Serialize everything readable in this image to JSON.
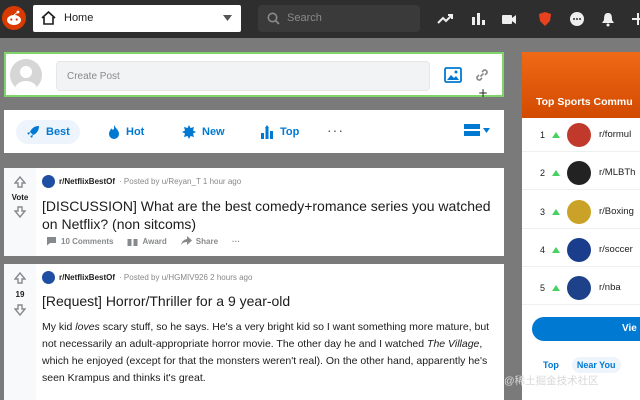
{
  "header": {
    "feed_selector": "Home",
    "search_placeholder": "Search",
    "icons": [
      "reddit-logo",
      "home-icon",
      "trending-icon",
      "stats-icon",
      "video-icon",
      "shield-icon",
      "chat-icon",
      "bell-icon",
      "plus-icon"
    ]
  },
  "create_post": {
    "placeholder": "Create Post"
  },
  "sort": {
    "items": [
      {
        "label": "Best",
        "icon": "rocket-icon",
        "active": true
      },
      {
        "label": "Hot",
        "icon": "flame-icon",
        "active": false
      },
      {
        "label": "New",
        "icon": "burst-icon",
        "active": false
      },
      {
        "label": "Top",
        "icon": "bar-chart-icon",
        "active": false
      }
    ],
    "more": "···"
  },
  "posts": [
    {
      "subreddit": "r/NetflixBestOf",
      "byline": "· Posted by u/Reyan_T 1 hour ago",
      "votes": "Vote",
      "title": "[DISCUSSION] What are the best comedy+romance series you watched on Netflix? (non sitcoms)",
      "actions": {
        "comments": "10 Comments",
        "award": "Award",
        "share": "Share",
        "more": "···"
      }
    },
    {
      "subreddit": "r/NetflixBestOf",
      "byline": "· Posted by u/HGMIV926 2 hours ago",
      "votes": "19",
      "title": "[Request] Horror/Thriller for a 9 year-old",
      "body_parts": {
        "p1": "My kid ",
        "p1_em": "loves",
        "p2": " scary stuff, so he says. He's a very bright kid so I want something more mature, but not necessarily an adult-appropriate horror movie. The other day he and I watched ",
        "p2_em": "The Village",
        "p3": ", which he enjoyed (except for that the monsters weren't real). On the other hand, apparently he's seen Krampus and thinks it's great."
      }
    }
  ],
  "sidebar": {
    "title": "Top Sports Commu",
    "communities": [
      {
        "rank": "1",
        "name": "r/formul",
        "color": "#c0392b"
      },
      {
        "rank": "2",
        "name": "r/MLBTh",
        "color": "#222222"
      },
      {
        "rank": "3",
        "name": "r/Boxing",
        "color": "#c9a227"
      },
      {
        "rank": "4",
        "name": "r/soccer",
        "color": "#1a3e8c"
      },
      {
        "rank": "5",
        "name": "r/nba",
        "color": "#1d428a"
      }
    ],
    "view_button": "Vie",
    "tabs": [
      "Top",
      "Near You"
    ]
  },
  "watermark": "@稀土掘金技术社区",
  "colors": {
    "accent": "#0079d3",
    "upvote": "#46d160",
    "banner": "#ef6a17"
  }
}
